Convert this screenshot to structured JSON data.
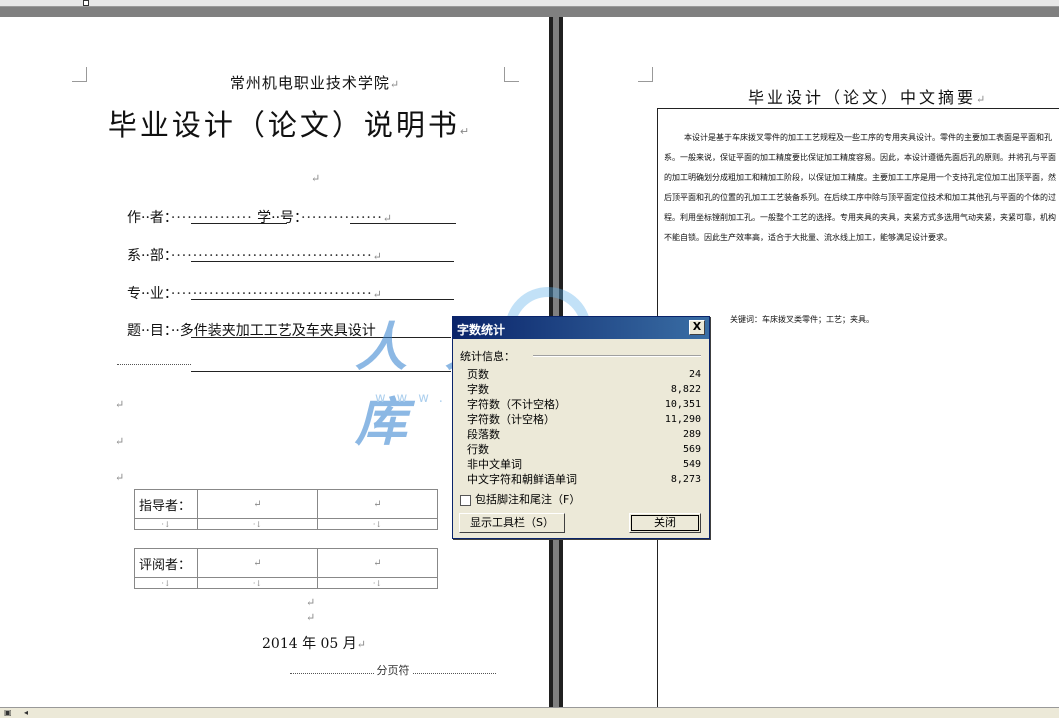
{
  "left_page": {
    "school": "常州机电职业技术学院",
    "title": "毕业设计（论文）说明书",
    "paragraph_mark": "↵",
    "author_label": "作··者：",
    "author_dots": "···············",
    "student_id_label": "学··号：",
    "student_id_dots": "···············",
    "dept_label": "系··部：",
    "dept_dots": "·····································",
    "major_label": "专··业：",
    "major_dots": "·····································",
    "topic_label": "题··目：",
    "topic_value": "··多件装夹加工工艺及车夹具设计",
    "topic_dots_line2": "···········",
    "advisor_label": "指导者：",
    "reviewer_label": "评阅者：",
    "cell_mark": "↵",
    "small_mark": "·↓",
    "date": "2014 年 05 月",
    "page_break": "分页符"
  },
  "right_page": {
    "abstract_title": "毕业设计（论文）中文摘要",
    "abstract_body": "本设计是基于车床拨叉零件的加工工艺规程及一些工序的专用夹具设计。零件的主要加工表面是平面和孔系。一般来说，保证平面的加工精度要比保证加工精度容易。因此，本设计遵循先面后孔的原则。并将孔与平面的加工明确划分成粗加工和精加工阶段，以保证加工精度。主要加工工序是用一个支持孔定位加工出顶平面，然后顶平面和孔的位置的孔加工工艺装备系列。在后续工序中除与顶平面定位技术和加工其他孔与平面的个体的过程。利用坐标镗削加工孔。一般整个工艺的选择。专用夹具的夹具，夹紧方式多选用气动夹紧，夹紧可靠，机构不能自锁。因此生产效率高，适合于大批量、流水线上加工，能够满足设计要求。",
    "keywords": "关键词：车床拨叉类零件；工艺；夹具。"
  },
  "watermark": {
    "text": "人人文库",
    "url": "www.renrendoc.com"
  },
  "dialog": {
    "title": "字数统计",
    "close_glyph": "X",
    "group_label": "统计信息：",
    "stats": [
      {
        "label": "页数",
        "value": "24"
      },
      {
        "label": "字数",
        "value": "8,822"
      },
      {
        "label": "字符数（不计空格）",
        "value": "10,351"
      },
      {
        "label": "字符数（计空格）",
        "value": "11,290"
      },
      {
        "label": "段落数",
        "value": "289"
      },
      {
        "label": "行数",
        "value": "569"
      },
      {
        "label": "非中文单词",
        "value": "549"
      },
      {
        "label": "中文字符和朝鲜语单词",
        "value": "8,273"
      }
    ],
    "checkbox_label": "包括脚注和尾注（F）",
    "toolbar_button": "显示工具栏（S）",
    "close_button": "关闭"
  },
  "statusbar": {
    "view_icon": "▣",
    "scroll_left": "◂"
  }
}
